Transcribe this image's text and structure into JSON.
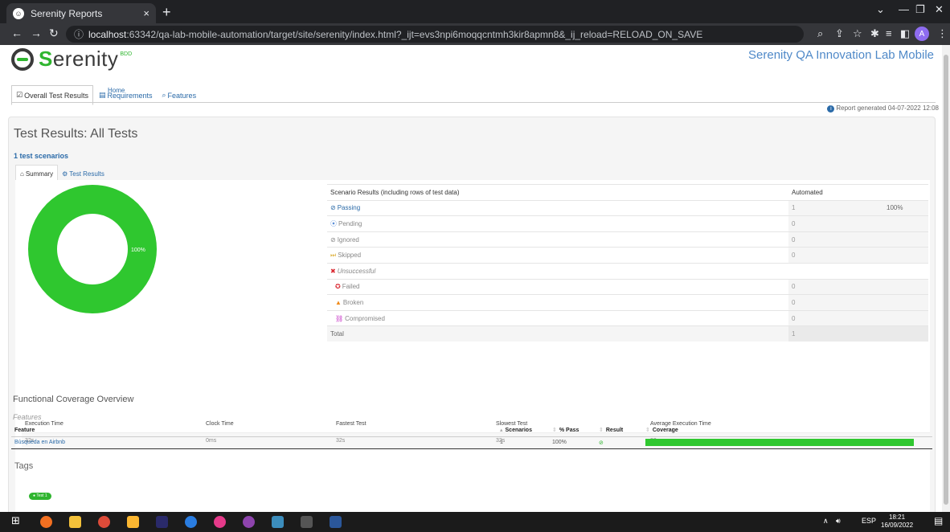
{
  "browser": {
    "tab_title": "Serenity Reports",
    "tab_close": "×",
    "new_tab": "+",
    "url_host": "localhost",
    "url_rest": ":63342/qa-lab-mobile-automation/target/site/serenity/index.html?_ijt=evs3npi6moqqcntmh3kir8apmn8&_ij_reload=RELOAD_ON_SAVE",
    "profile_initial": "A"
  },
  "header": {
    "logo_text_first": "S",
    "logo_text_rest": "erenity",
    "logo_badge": "BDD",
    "home_link": "Home",
    "project_title": "Serenity QA Innovation Lab Mobile"
  },
  "nav": {
    "overall": "Overall Test Results",
    "requirements": "Requirements",
    "features": "Features"
  },
  "report_generated": "Report generated 04-07-2022 12:08",
  "panel": {
    "title": "Test Results: All Tests",
    "scenario_count": "1 test scenarios",
    "tab_summary": "Summary",
    "tab_results": "Test Results"
  },
  "chart_data": {
    "type": "pie",
    "categories": [
      "Passing"
    ],
    "values": [
      100
    ],
    "labels": [
      "100%"
    ],
    "colors": [
      "#2fc72f"
    ]
  },
  "results": {
    "header_label": "Scenario Results (including rows of test data)",
    "header_automated": "Automated",
    "rows": [
      {
        "label": "Passing",
        "count": "1",
        "pct": "100%"
      },
      {
        "label": "Pending",
        "count": "0",
        "pct": ""
      },
      {
        "label": "Ignored",
        "count": "0",
        "pct": ""
      },
      {
        "label": "Skipped",
        "count": "0",
        "pct": ""
      },
      {
        "label": "Unsuccessful",
        "count": "",
        "pct": ""
      },
      {
        "label": "Failed",
        "count": "0",
        "pct": ""
      },
      {
        "label": "Broken",
        "count": "0",
        "pct": ""
      },
      {
        "label": "Compromised",
        "count": "0",
        "pct": ""
      },
      {
        "label": "Total",
        "count": "1",
        "pct": ""
      }
    ]
  },
  "timing": {
    "headers": [
      "Execution Time",
      "Clock Time",
      "Fastest Test",
      "Slowest Test",
      "Average Execution Time"
    ],
    "values": [
      "32s",
      "0ms",
      "32s",
      "32s",
      "32s"
    ]
  },
  "coverage": {
    "title": "Functional Coverage Overview",
    "subtitle": "Features",
    "headers": [
      "Feature",
      "Scenarios",
      "% Pass",
      "Result",
      "Coverage"
    ],
    "rows": [
      {
        "feature": "Búsqueda en Airbnb",
        "scenarios": "1",
        "pass": "100%",
        "result_icon": "check-icon",
        "coverage": 100
      }
    ]
  },
  "tags": {
    "title": "Tags",
    "items": [
      {
        "label": "Test",
        "count": "1"
      }
    ]
  },
  "taskbar": {
    "lang": "ESP",
    "time": "18:21",
    "date": "16/09/2022"
  }
}
